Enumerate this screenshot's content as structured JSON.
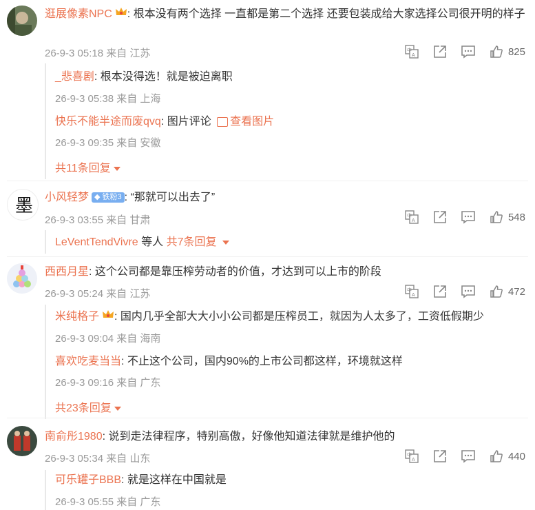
{
  "comments": [
    {
      "user": "逛展像素NPC",
      "text": "根本没有两个选择 一直都是第二个选择 还要包装成给大家选择公司很开明的样子",
      "meta": "26-9-3 05:18 来自 江苏",
      "likes": "825",
      "replies": [
        {
          "user": "_悲喜剧",
          "text": "根本没得选！就是被迫离职",
          "meta": "26-9-3 05:38 来自 上海"
        },
        {
          "user": "快乐不能半途而废qvq",
          "text": "图片评论",
          "link": "查看图片",
          "meta": "26-9-3 09:35 来自 安徽"
        }
      ],
      "more": "共11条回复"
    },
    {
      "user": "小风轻梦",
      "badge": "铁粉3",
      "text": "“那就可以出去了”",
      "meta": "26-9-3 03:55 来自 甘肃",
      "likes": "548",
      "summary_user": "LeVentTendVivre",
      "summary_mid": "等人",
      "summary_more": "共7条回复"
    },
    {
      "user": "西西月星",
      "text": "这个公司都是靠压榨劳动者的价值，才达到可以上市的阶段",
      "meta": "26-9-3 05:24 来自 江苏",
      "likes": "472",
      "replies": [
        {
          "user": "米纯格子",
          "text": "国内几乎全部大大小小公司都是压榨员工，就因为人太多了，工资低假期少",
          "meta": "26-9-3 09:04 来自 海南"
        },
        {
          "user": "喜欢吃麦当当",
          "text": "不止这个公司，国内90%的上市公司都这样，环境就这样",
          "meta": "26-9-3 09:16 来自 广东"
        }
      ],
      "more": "共23条回复"
    },
    {
      "user": "南俞彤1980",
      "text": "说到走法律程序，特别高傲，好像他知道法律就是维护他的",
      "meta": "26-9-3 05:34 来自 山东",
      "likes": "440",
      "replies": [
        {
          "user": "可乐罐子BBB",
          "text": "就是这样在中国就是",
          "meta": "26-9-3 05:55 来自 广东"
        }
      ]
    }
  ],
  "icons": [
    "translate-icon",
    "share-icon",
    "comment-icon",
    "like-icon"
  ],
  "colors": {
    "name": "#eb7350",
    "meta": "#999999",
    "text": "#333333"
  }
}
